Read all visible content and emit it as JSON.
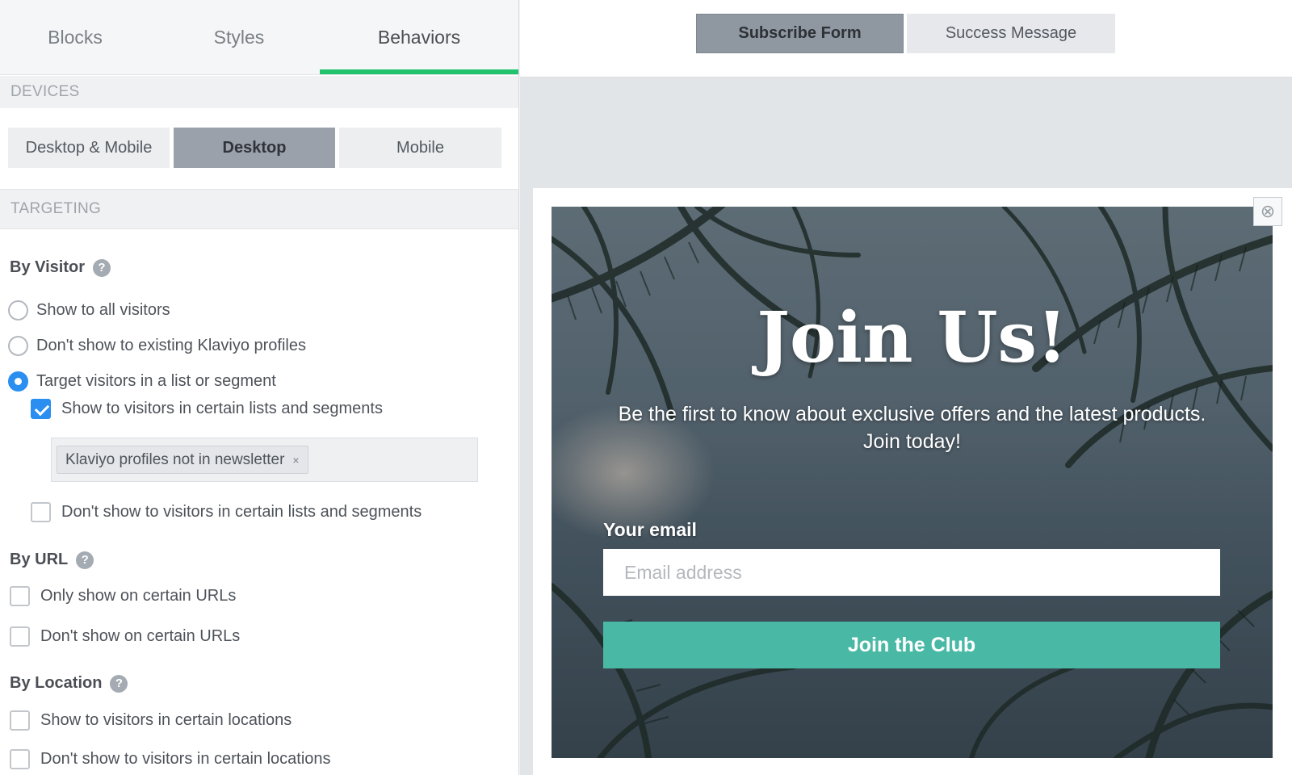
{
  "editor_tabs": [
    {
      "label": "Blocks"
    },
    {
      "label": "Styles"
    },
    {
      "label": "Behaviors",
      "active": true
    }
  ],
  "devices": {
    "section_title": "DEVICES",
    "options": [
      "Desktop & Mobile",
      "Desktop",
      "Mobile"
    ],
    "selected": "Desktop"
  },
  "targeting": {
    "section_title": "TARGETING",
    "by_visitor": {
      "title": "By Visitor",
      "help_icon": "question-icon",
      "options": [
        {
          "label": "Show to all visitors",
          "selected": false
        },
        {
          "label": "Don't show to existing Klaviyo profiles",
          "selected": false
        },
        {
          "label": "Target visitors in a list or segment",
          "selected": true
        }
      ],
      "include_lists": {
        "label": "Show to visitors in certain lists and segments",
        "checked": true
      },
      "tag": "Klaviyo profiles not in newsletter",
      "tag_remove": "×",
      "exclude_lists": {
        "label": "Don't show to visitors in certain lists and segments",
        "checked": false
      }
    },
    "by_url": {
      "title": "By URL",
      "options": [
        {
          "label": "Only show on certain URLs",
          "checked": false
        },
        {
          "label": "Don't show on certain URLs",
          "checked": false
        }
      ]
    },
    "by_location": {
      "title": "By Location",
      "options": [
        {
          "label": "Show to visitors in certain locations",
          "checked": false
        },
        {
          "label": "Don't show to visitors in certain locations",
          "checked": false
        }
      ]
    }
  },
  "form_tabs": [
    {
      "label": "Subscribe Form",
      "active": true
    },
    {
      "label": "Success Message",
      "active": false
    }
  ],
  "popup": {
    "close_symbol": "⊗",
    "title": "Join Us!",
    "subtitle": "Be the first to know about exclusive offers and the latest products. Join today!",
    "email_label": "Your email",
    "email_placeholder": "Email address",
    "email_value": "",
    "submit_label": "Join the Club",
    "accent_color": "#49b9a6"
  },
  "colors": {
    "tab_active_underline": "#22c36f",
    "checkbox_checked": "#2a8ff0",
    "device_selected": "#9aa1aa"
  }
}
